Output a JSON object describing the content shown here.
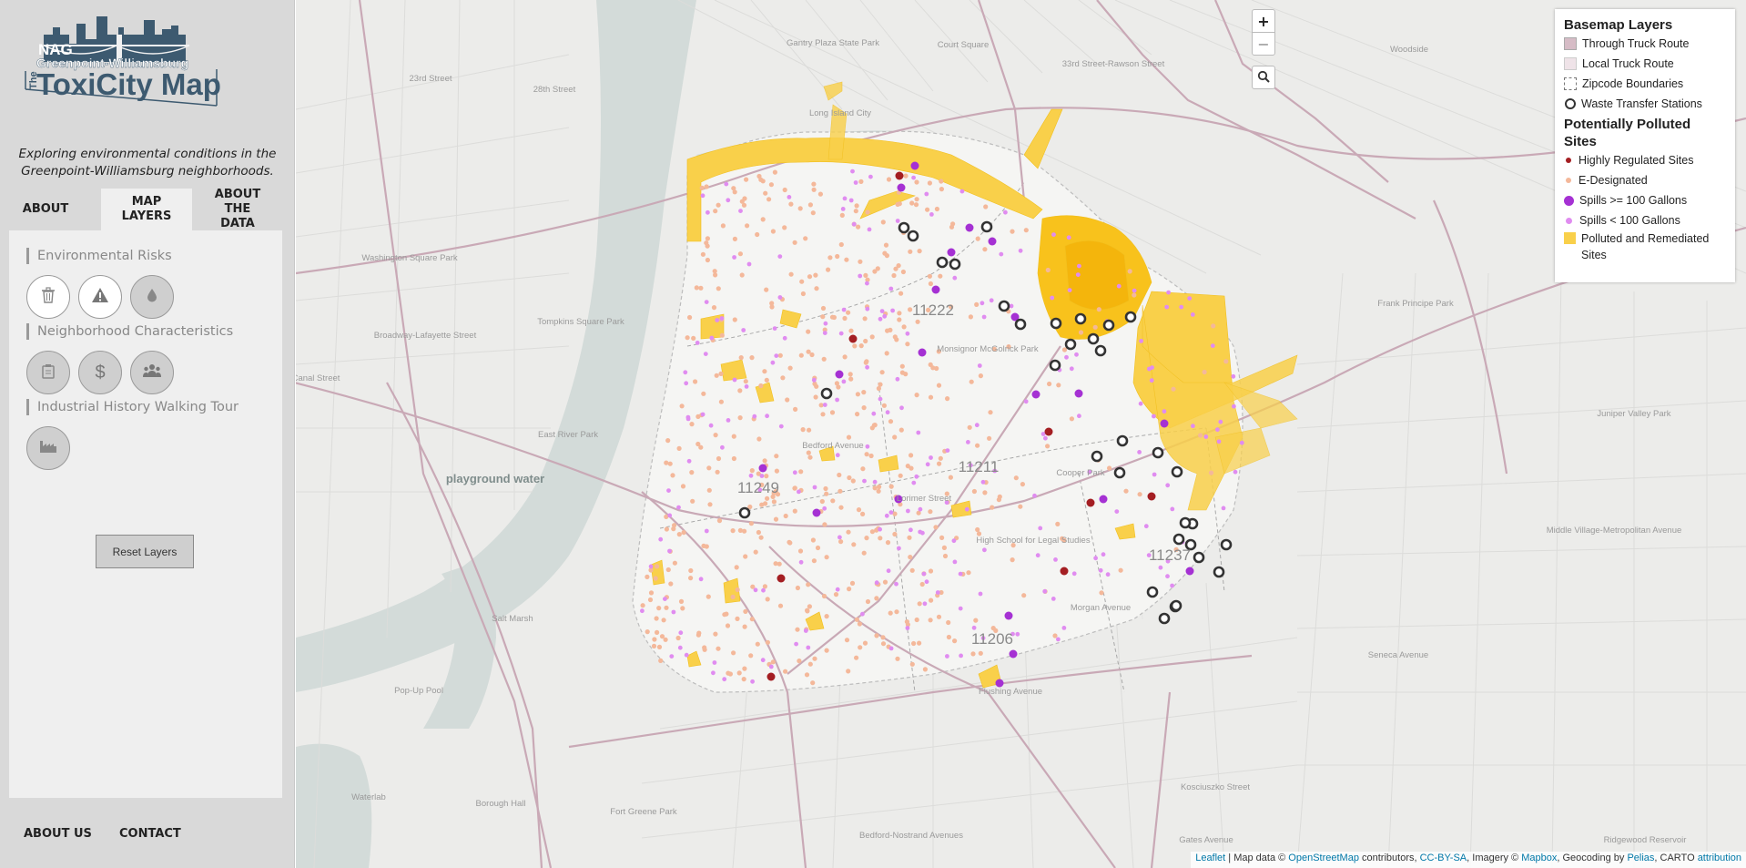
{
  "sidebar": {
    "logo": {
      "org": "NAG",
      "line1": "Greenpoint-Williamsburg",
      "the": "The",
      "title": "ToxiCity Map"
    },
    "tagline": "Exploring environmental conditions in the Greenpoint-Williamsburg neighborhoods.",
    "tabs": [
      {
        "label": "ABOUT",
        "active": false
      },
      {
        "label": "MAP LAYERS",
        "active": true
      },
      {
        "label": "ABOUT THE DATA",
        "active": false
      }
    ],
    "sections": [
      {
        "title": "Environmental Risks",
        "buttons": [
          {
            "icon": "trash-icon",
            "on": true
          },
          {
            "icon": "warning-icon",
            "on": true
          },
          {
            "icon": "droplet-icon",
            "on": false
          }
        ]
      },
      {
        "title": "Neighborhood Characteristics",
        "buttons": [
          {
            "icon": "clipboard-icon",
            "on": false
          },
          {
            "icon": "dollar-icon",
            "on": false
          },
          {
            "icon": "people-icon",
            "on": false
          }
        ]
      },
      {
        "title": "Industrial History Walking Tour",
        "buttons": [
          {
            "icon": "factory-icon",
            "on": false
          }
        ]
      }
    ],
    "reset_label": "Reset Layers",
    "footer": {
      "about_us": "ABOUT US",
      "contact": "CONTACT"
    }
  },
  "map": {
    "controls": {
      "zoom_in": "+",
      "zoom_out": "−",
      "search_icon": "search-icon"
    },
    "legend": {
      "basemap_heading": "Basemap Layers",
      "basemap_items": [
        {
          "label": "Through Truck Route",
          "color": "#d6bcc6"
        },
        {
          "label": "Local Truck Route",
          "color": "#efe3e8"
        },
        {
          "label": "Zipcode Boundaries",
          "color": "#ffffff"
        },
        {
          "label": "Waste Transfer Stations",
          "color": "#333333"
        }
      ],
      "polluted_heading": "Potentially Polluted Sites",
      "polluted_items": [
        {
          "label": "Highly Regulated Sites",
          "color": "#a41e22"
        },
        {
          "label": "E-Designated",
          "color": "#f4b89a"
        },
        {
          "label": "Spills >= 100 Gallons",
          "color": "#a531d3"
        },
        {
          "label": "Spills < 100 Gallons",
          "color": "#e08cf0"
        },
        {
          "label": "Polluted and Remediated Sites",
          "color": "#f9d04a"
        }
      ]
    },
    "zip_labels": [
      "11222",
      "11211",
      "11249",
      "11206",
      "11237"
    ],
    "place_labels": [
      "Gantry Plaza State Park",
      "Court Square",
      "Long Island City",
      "Woodside",
      "23rd Street",
      "28th Street",
      "Washington Square Park",
      "Tompkins Square Park",
      "Broadway-Lafayette Street",
      "Canal Street",
      "East River Park",
      "Monsignor McGolrick Park",
      "Frank Principe Park",
      "Juniper Valley Park",
      "Middle Village-Metropolitan Avenue",
      "Seneca Avenue",
      "Cooper Park",
      "High School for Legal Studies",
      "Morgan Avenue",
      "Flushing Avenue",
      "Bedford Avenue",
      "Lorimer Street",
      "Kosciuszko Street",
      "Bedford-Nostrand Avenues",
      "Gates Avenue",
      "Ridgewood Reservoir",
      "Fort Greene Park",
      "Borough Hall",
      "Pop-Up Pool",
      "Salt Marsh",
      "playground water",
      "Waterlab",
      "33rd Street-Rawson Street"
    ],
    "attribution": {
      "leaflet": "Leaflet",
      "text1": " | Map data © ",
      "osm": "OpenStreetMap",
      "text2": " contributors, ",
      "ccbysa": "CC-BY-SA",
      "text3": ", Imagery © ",
      "mapbox": "Mapbox",
      "text4": ", Geocoding by ",
      "pelias": "Pelias",
      "text5": ", CARTO ",
      "attribution": "attribution"
    }
  },
  "colors": {
    "water": "#d3dbd9",
    "land": "#ececea",
    "truck_route": "#c9a9b6",
    "polluted": "#f9d04a",
    "e_designated": "#f4b89a",
    "spill_large": "#a531d3",
    "spill_small": "#e08cf0",
    "regulated": "#a41e22",
    "waste": "#333333"
  }
}
